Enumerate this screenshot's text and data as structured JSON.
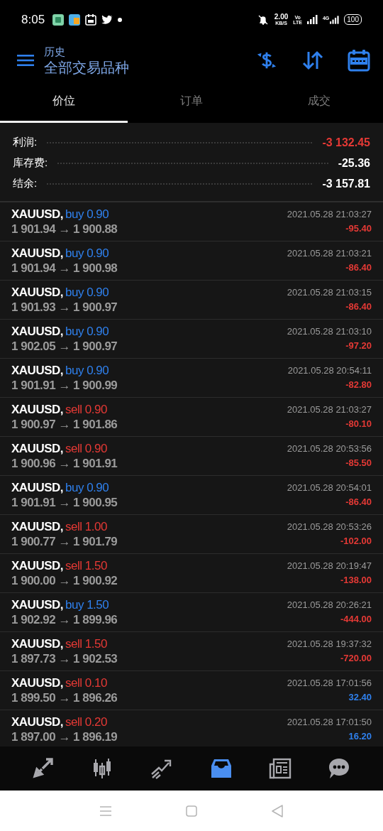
{
  "status_bar": {
    "time": "8:05",
    "speed": "2.00",
    "speed_unit": "KB/S",
    "volte_top": "Vo",
    "volte_bottom": "LTE",
    "network": "4G",
    "battery": "100"
  },
  "header": {
    "subtitle": "历史",
    "title": "全部交易品种"
  },
  "tabs": [
    {
      "label": "价位",
      "selected": true
    },
    {
      "label": "订单",
      "selected": false
    },
    {
      "label": "成交",
      "selected": false
    }
  ],
  "summary": [
    {
      "label": "利润:",
      "value": "-3 132.45",
      "color": "#e53935"
    },
    {
      "label": "库存费:",
      "value": "-25.36",
      "color": "#ffffff"
    },
    {
      "label": "结余:",
      "value": "-3 157.81",
      "color": "#ffffff"
    }
  ],
  "trades": [
    {
      "symbol": "XAUUSD,",
      "kind": "buy",
      "side": "buy 0.90",
      "prices": "1 901.94 → 1 900.88",
      "time": "2021.05.28 21:03:27",
      "profit": "-95.40",
      "gain": false
    },
    {
      "symbol": "XAUUSD,",
      "kind": "buy",
      "side": "buy 0.90",
      "prices": "1 901.94 → 1 900.98",
      "time": "2021.05.28 21:03:21",
      "profit": "-86.40",
      "gain": false
    },
    {
      "symbol": "XAUUSD,",
      "kind": "buy",
      "side": "buy 0.90",
      "prices": "1 901.93 → 1 900.97",
      "time": "2021.05.28 21:03:15",
      "profit": "-86.40",
      "gain": false
    },
    {
      "symbol": "XAUUSD,",
      "kind": "buy",
      "side": "buy 0.90",
      "prices": "1 902.05 → 1 900.97",
      "time": "2021.05.28 21:03:10",
      "profit": "-97.20",
      "gain": false
    },
    {
      "symbol": "XAUUSD,",
      "kind": "buy",
      "side": "buy 0.90",
      "prices": "1 901.91 → 1 900.99",
      "time": "2021.05.28 20:54:11",
      "profit": "-82.80",
      "gain": false
    },
    {
      "symbol": "XAUUSD,",
      "kind": "sell",
      "side": "sell 0.90",
      "prices": "1 900.97 → 1 901.86",
      "time": "2021.05.28 21:03:27",
      "profit": "-80.10",
      "gain": false
    },
    {
      "symbol": "XAUUSD,",
      "kind": "sell",
      "side": "sell 0.90",
      "prices": "1 900.96 → 1 901.91",
      "time": "2021.05.28 20:53:56",
      "profit": "-85.50",
      "gain": false
    },
    {
      "symbol": "XAUUSD,",
      "kind": "buy",
      "side": "buy 0.90",
      "prices": "1 901.91 → 1 900.95",
      "time": "2021.05.28 20:54:01",
      "profit": "-86.40",
      "gain": false
    },
    {
      "symbol": "XAUUSD,",
      "kind": "sell",
      "side": "sell 1.00",
      "prices": "1 900.77 → 1 901.79",
      "time": "2021.05.28 20:53:26",
      "profit": "-102.00",
      "gain": false
    },
    {
      "symbol": "XAUUSD,",
      "kind": "sell",
      "side": "sell 1.50",
      "prices": "1 900.00 → 1 900.92",
      "time": "2021.05.28 20:19:47",
      "profit": "-138.00",
      "gain": false
    },
    {
      "symbol": "XAUUSD,",
      "kind": "buy",
      "side": "buy 1.50",
      "prices": "1 902.92 → 1 899.96",
      "time": "2021.05.28 20:26:21",
      "profit": "-444.00",
      "gain": false
    },
    {
      "symbol": "XAUUSD,",
      "kind": "sell",
      "side": "sell 1.50",
      "prices": "1 897.73 → 1 902.53",
      "time": "2021.05.28 19:37:32",
      "profit": "-720.00",
      "gain": false
    },
    {
      "symbol": "XAUUSD,",
      "kind": "sell",
      "side": "sell 0.10",
      "prices": "1 899.50 → 1 896.26",
      "time": "2021.05.28 17:01:56",
      "profit": "32.40",
      "gain": true
    },
    {
      "symbol": "XAUUSD,",
      "kind": "sell",
      "side": "sell 0.20",
      "prices": "1 897.00 → 1 896.19",
      "time": "2021.05.28 17:01:50",
      "profit": "16.20",
      "gain": true
    }
  ],
  "bottom_nav": [
    {
      "kind": "quotes",
      "selected": false
    },
    {
      "kind": "chart",
      "selected": false
    },
    {
      "kind": "trade",
      "selected": false
    },
    {
      "kind": "history",
      "selected": true
    },
    {
      "kind": "news",
      "selected": false
    },
    {
      "kind": "chat",
      "selected": false
    }
  ]
}
